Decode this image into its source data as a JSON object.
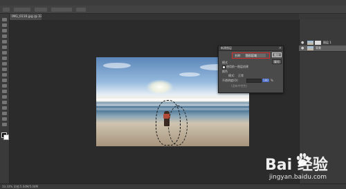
{
  "document": {
    "tab_label": "IMG_0116.jpg @ 33.3%(RGB/8)"
  },
  "dialog": {
    "title": "新建图层",
    "name_label": "名称:",
    "name_value": "鱼形区域",
    "ok_label": "确定",
    "reset_label": "复位",
    "section_shape": "模式",
    "checkbox_label": "使用前一图层创建",
    "section_color": "颜色",
    "mode_label": "模式:",
    "mode_value": "正常",
    "opacity_label": "不透明度(O):",
    "opacity_value": "100",
    "opacity_unit": "%",
    "extra_label": "(没有中性色)"
  },
  "layers": {
    "row1_name": "图层 1",
    "row2_name": "背景"
  },
  "status": {
    "text": "33.33%   文档:5.04M/5.04M"
  },
  "watermark": {
    "main": "Bai 经验",
    "url": "jingyan.baidu.com"
  },
  "colors": {
    "accent_red": "#d92e2e",
    "highlight_blue": "#3f63c2"
  }
}
